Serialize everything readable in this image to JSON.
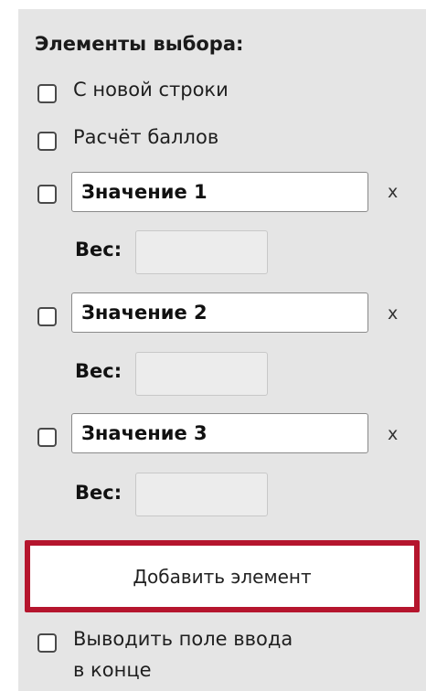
{
  "section": {
    "heading": "Элементы выбора:"
  },
  "options": {
    "new_line_label": "С новой строки",
    "scoring_label": "Расчёт баллов"
  },
  "choices": [
    {
      "value": "Значение 1",
      "remove_label": "x",
      "weight_label": "Вес:",
      "weight_value": ""
    },
    {
      "value": "Значение 2",
      "remove_label": "x",
      "weight_label": "Вес:",
      "weight_value": ""
    },
    {
      "value": "Значение 3",
      "remove_label": "x",
      "weight_label": "Вес:",
      "weight_value": ""
    }
  ],
  "add_button_label": "Добавить элемент",
  "footer_option": {
    "line1": "Выводить поле ввода",
    "line2": "в конце"
  },
  "colors": {
    "panel_background": "#e5e5e5",
    "add_button_border": "#b5152d"
  }
}
